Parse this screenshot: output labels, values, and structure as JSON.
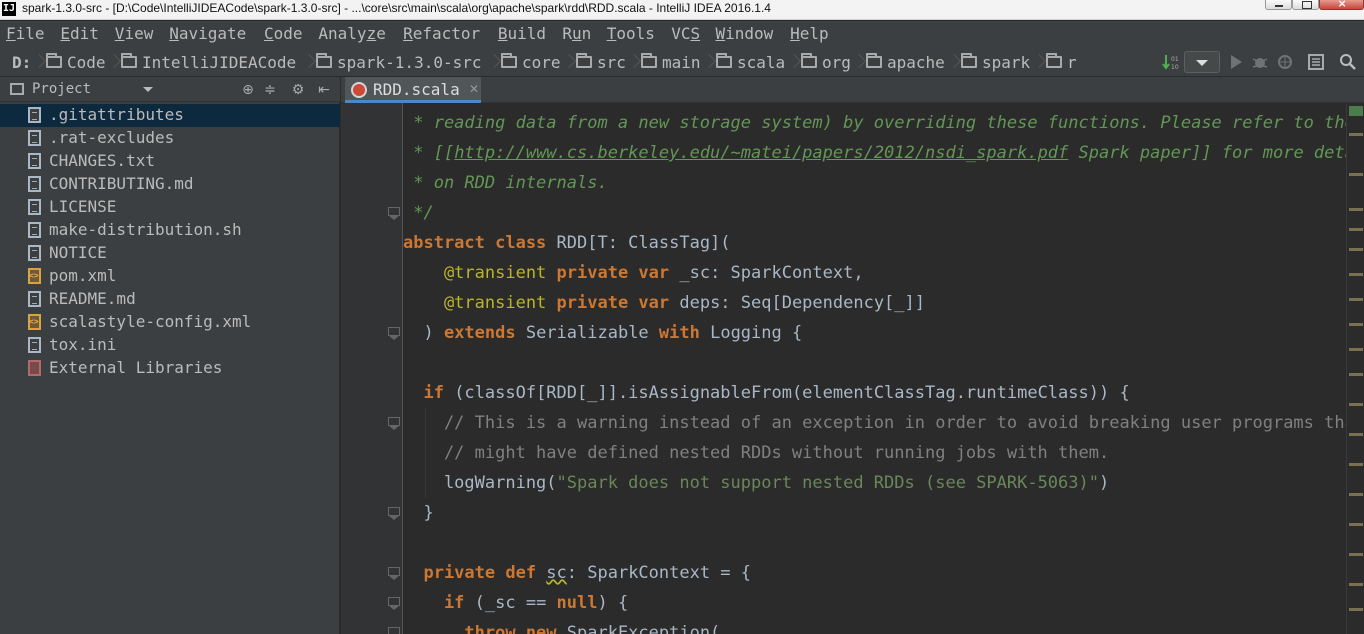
{
  "window": {
    "title": "spark-1.3.0-src - [D:\\Code\\IntelliJIDEACode\\spark-1.3.0-src] - ...\\core\\src\\main\\scala\\org\\apache\\spark\\rdd\\RDD.scala - IntelliJ IDEA 2016.1.4",
    "app_icon_text": "IJ"
  },
  "menu": [
    {
      "label": "File",
      "mnemonic": "F"
    },
    {
      "label": "Edit",
      "mnemonic": "E"
    },
    {
      "label": "View",
      "mnemonic": "V"
    },
    {
      "label": "Navigate",
      "mnemonic": "N"
    },
    {
      "label": "Code",
      "mnemonic": "C"
    },
    {
      "label": "Analyze",
      "mnemonic": "z"
    },
    {
      "label": "Refactor",
      "mnemonic": "R"
    },
    {
      "label": "Build",
      "mnemonic": "B"
    },
    {
      "label": "Run",
      "mnemonic": "u"
    },
    {
      "label": "Tools",
      "mnemonic": "T"
    },
    {
      "label": "VCS",
      "mnemonic": "S"
    },
    {
      "label": "Window",
      "mnemonic": "W"
    },
    {
      "label": "Help",
      "mnemonic": "H"
    }
  ],
  "breadcrumbs": [
    "D:",
    "Code",
    "IntelliJIDEACode",
    "spark-1.3.0-src",
    "core",
    "src",
    "main",
    "scala",
    "org",
    "apache",
    "spark",
    "r"
  ],
  "toolbar_icons": [
    "sort-icon",
    "run-config-dropdown",
    "run-icon",
    "debug-icon",
    "coverage-icon",
    "stop-icon",
    "project-structure-icon",
    "search-icon"
  ],
  "project_panel": {
    "title": "Project",
    "header_icons": [
      "locate-icon",
      "collapse-icon",
      "gear-icon",
      "hide-icon"
    ],
    "items": [
      {
        "label": ".gitattributes",
        "icon": "text-file-icon",
        "selected": true
      },
      {
        "label": ".rat-excludes",
        "icon": "text-file-icon"
      },
      {
        "label": "CHANGES.txt",
        "icon": "text-file-icon"
      },
      {
        "label": "CONTRIBUTING.md",
        "icon": "text-file-icon"
      },
      {
        "label": "LICENSE",
        "icon": "text-file-icon"
      },
      {
        "label": "make-distribution.sh",
        "icon": "text-file-icon"
      },
      {
        "label": "NOTICE",
        "icon": "text-file-icon"
      },
      {
        "label": "pom.xml",
        "icon": "xml-file-icon"
      },
      {
        "label": "README.md",
        "icon": "text-file-icon"
      },
      {
        "label": "scalastyle-config.xml",
        "icon": "xml-file-icon"
      },
      {
        "label": "tox.ini",
        "icon": "text-file-icon"
      },
      {
        "label": "External Libraries",
        "icon": "library-icon"
      }
    ]
  },
  "editor": {
    "tab": {
      "label": "RDD.scala",
      "icon": "scala-file-icon"
    },
    "lines": [
      [
        {
          "c": "c-doc",
          "t": " * reading data from a new storage system) by overriding these functions. Please refer to the"
        }
      ],
      [
        {
          "c": "c-doc",
          "t": " * [["
        },
        {
          "c": "c-doclink",
          "t": "http://www.cs.berkeley.edu/~matei/papers/2012/nsdi_spark.pdf"
        },
        {
          "c": "c-doc",
          "t": " Spark paper]] for more details"
        }
      ],
      [
        {
          "c": "c-doc",
          "t": " * on RDD internals."
        }
      ],
      [
        {
          "c": "c-doc",
          "t": " */"
        }
      ],
      [
        {
          "c": "kw",
          "t": "abstract class "
        },
        {
          "c": "",
          "t": "RDD[T: ClassTag]("
        }
      ],
      [
        {
          "c": "ann",
          "t": "    @transient "
        },
        {
          "c": "kw",
          "t": "private var "
        },
        {
          "c": "",
          "t": "_sc: SparkContext,"
        }
      ],
      [
        {
          "c": "ann",
          "t": "    @transient "
        },
        {
          "c": "kw",
          "t": "private var "
        },
        {
          "c": "",
          "t": "deps: Seq[Dependency[_]]"
        }
      ],
      [
        {
          "c": "",
          "t": "  ) "
        },
        {
          "c": "kw",
          "t": "extends "
        },
        {
          "c": "",
          "t": "Serializable "
        },
        {
          "c": "kw",
          "t": "with "
        },
        {
          "c": "",
          "t": "Logging {"
        }
      ],
      [
        {
          "c": "",
          "t": ""
        }
      ],
      [
        {
          "c": "kw",
          "t": "  if "
        },
        {
          "c": "",
          "t": "(classOf[RDD[_]].isAssignableFrom(elementClassTag.runtimeClass)) {"
        }
      ],
      [
        {
          "c": "c-cmt",
          "t": "    // This is a warning instead of an exception in order to avoid breaking user programs that"
        }
      ],
      [
        {
          "c": "c-cmt",
          "t": "    // might have defined nested RDDs without running jobs with them."
        }
      ],
      [
        {
          "c": "",
          "t": "    logWarning("
        },
        {
          "c": "str",
          "t": "\"Spark does not support nested RDDs (see SPARK-5063)\""
        },
        {
          "c": "",
          "t": ")"
        }
      ],
      [
        {
          "c": "",
          "t": "  }"
        }
      ],
      [
        {
          "c": "",
          "t": ""
        }
      ],
      [
        {
          "c": "kw",
          "t": "  private def "
        },
        {
          "c": "warn-u",
          "t": "sc"
        },
        {
          "c": "",
          "t": ": SparkContext = {"
        }
      ],
      [
        {
          "c": "kw",
          "t": "    if "
        },
        {
          "c": "",
          "t": "(_sc == "
        },
        {
          "c": "kw",
          "t": "null"
        },
        {
          "c": "",
          "t": ") {"
        }
      ],
      [
        {
          "c": "kw",
          "t": "      throw new "
        },
        {
          "c": "",
          "t": "SparkException("
        }
      ]
    ]
  },
  "colors": {
    "background": "#2b2b2b",
    "panel": "#3c3f41",
    "keyword": "#cc7832",
    "doc_comment": "#629755",
    "line_comment": "#808080",
    "string": "#6a8759",
    "annotation": "#bbb529",
    "selection": "#0d293e"
  }
}
